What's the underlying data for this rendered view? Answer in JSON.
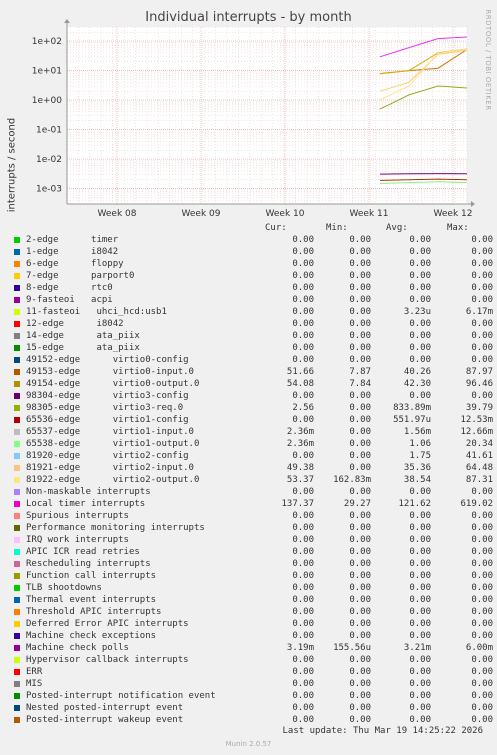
{
  "chart_data": {
    "type": "line",
    "title": "Individual interrupts - by month",
    "ylabel": "interrupts / second",
    "yscale": "log",
    "ylim": [
      0.0003,
      300
    ],
    "yticks": [
      "1e+02",
      "1e+01",
      "1e+00",
      "1e-01",
      "1e-02",
      "1e-03"
    ],
    "xticks": [
      "Week 08",
      "Week 09",
      "Week 10",
      "Week 11",
      "Week 12"
    ],
    "grid": true,
    "series": [
      {
        "name": "49153-edge virtio0-input.0",
        "color": "#cc7700",
        "values": [
          7.87,
          10,
          12,
          51.66
        ]
      },
      {
        "name": "49154-edge virtio0-output.0",
        "color": "#ddaa00",
        "values": [
          7.84,
          10,
          40,
          54.08
        ]
      },
      {
        "name": "98305-edge virtio3-req.0",
        "color": "#99aa22",
        "values": [
          0.5,
          1.5,
          3,
          2.56
        ]
      },
      {
        "name": "Local timer interrupts",
        "color": "#ee33ee",
        "values": [
          29.27,
          60,
          121.62,
          137.37
        ]
      },
      {
        "name": "81921-edge virtio2-input.0",
        "color": "#ffcc66",
        "values": [
          2,
          4,
          35.36,
          49.38
        ]
      },
      {
        "name": "81922-edge virtio2-output.0",
        "color": "#ffe099",
        "values": [
          1,
          3,
          38.54,
          53.37
        ]
      },
      {
        "name": "Machine check polls",
        "color": "#800080",
        "values": [
          0.0031,
          0.0032,
          0.00321,
          0.0032
        ]
      },
      {
        "name": "65538-edge virtio1-output.0",
        "color": "#88ee88",
        "values": [
          0.0015,
          0.0016,
          0.0017,
          0.0016
        ]
      },
      {
        "name": "65536-edge virtio1-config",
        "color": "#aa3300",
        "values": [
          0.0019,
          0.002,
          0.0021,
          0.002
        ]
      }
    ]
  },
  "side_credit": "RRDTOOL / TOBI OETIKER",
  "legend": {
    "headers": {
      "cur": "Cur:",
      "min": "Min:",
      "avg": "Avg:",
      "max": "Max:"
    },
    "rows": [
      {
        "label": "2-edge      timer",
        "color": "#00cc00",
        "cur": "0.00",
        "min": "0.00",
        "avg": "0.00",
        "max": "0.00"
      },
      {
        "label": "1-edge      i8042",
        "color": "#0066b3",
        "cur": "0.00",
        "min": "0.00",
        "avg": "0.00",
        "max": "0.00"
      },
      {
        "label": "6-edge      floppy",
        "color": "#ff8000",
        "cur": "0.00",
        "min": "0.00",
        "avg": "0.00",
        "max": "0.00"
      },
      {
        "label": "7-edge      parport0",
        "color": "#ffcc00",
        "cur": "0.00",
        "min": "0.00",
        "avg": "0.00",
        "max": "0.00"
      },
      {
        "label": "8-edge      rtc0",
        "color": "#330099",
        "cur": "0.00",
        "min": "0.00",
        "avg": "0.00",
        "max": "0.00"
      },
      {
        "label": "9-fasteoi   acpi",
        "color": "#990099",
        "cur": "0.00",
        "min": "0.00",
        "avg": "0.00",
        "max": "0.00"
      },
      {
        "label": "11-fasteoi   uhci_hcd:usb1",
        "color": "#ccff00",
        "cur": "0.00",
        "min": "0.00",
        "avg": "3.23u",
        "max": "6.17m"
      },
      {
        "label": "12-edge      i8042",
        "color": "#ff0000",
        "cur": "0.00",
        "min": "0.00",
        "avg": "0.00",
        "max": "0.00"
      },
      {
        "label": "14-edge      ata_piix",
        "color": "#808080",
        "cur": "0.00",
        "min": "0.00",
        "avg": "0.00",
        "max": "0.00"
      },
      {
        "label": "15-edge      ata_piix",
        "color": "#008f00",
        "cur": "0.00",
        "min": "0.00",
        "avg": "0.00",
        "max": "0.00"
      },
      {
        "label": "49152-edge      virtio0-config",
        "color": "#00487d",
        "cur": "0.00",
        "min": "0.00",
        "avg": "0.00",
        "max": "0.00"
      },
      {
        "label": "49153-edge      virtio0-input.0",
        "color": "#b35a00",
        "cur": "51.66",
        "min": "7.87",
        "avg": "40.26",
        "max": "87.97"
      },
      {
        "label": "49154-edge      virtio0-output.0",
        "color": "#b38f00",
        "cur": "54.08",
        "min": "7.84",
        "avg": "42.30",
        "max": "96.46"
      },
      {
        "label": "98304-edge      virtio3-config",
        "color": "#6b006b",
        "cur": "0.00",
        "min": "0.00",
        "avg": "0.00",
        "max": "0.00"
      },
      {
        "label": "98305-edge      virtio3-req.0",
        "color": "#8fb300",
        "cur": "2.56",
        "min": "0.00",
        "avg": "833.89m",
        "max": "39.79"
      },
      {
        "label": "65536-edge      virtio1-config",
        "color": "#b30000",
        "cur": "0.00",
        "min": "0.00",
        "avg": "551.97u",
        "max": "12.53m"
      },
      {
        "label": "65537-edge      virtio1-input.0",
        "color": "#bebebe",
        "cur": "2.36m",
        "min": "0.00",
        "avg": "1.56m",
        "max": "12.66m"
      },
      {
        "label": "65538-edge      virtio1-output.0",
        "color": "#80ff80",
        "cur": "2.36m",
        "min": "0.00",
        "avg": "1.06",
        "max": "20.34"
      },
      {
        "label": "81920-edge      virtio2-config",
        "color": "#80c9ff",
        "cur": "0.00",
        "min": "0.00",
        "avg": "1.75",
        "max": "41.61"
      },
      {
        "label": "81921-edge      virtio2-input.0",
        "color": "#ffc080",
        "cur": "49.38",
        "min": "0.00",
        "avg": "35.36",
        "max": "64.48"
      },
      {
        "label": "81922-edge      virtio2-output.0",
        "color": "#ffe680",
        "cur": "53.37",
        "min": "162.83m",
        "avg": "38.54",
        "max": "87.31"
      },
      {
        "label": "Non-maskable interrupts",
        "color": "#aa80ff",
        "cur": "0.00",
        "min": "0.00",
        "avg": "0.00",
        "max": "0.00"
      },
      {
        "label": "Local timer interrupts",
        "color": "#ee00cc",
        "cur": "137.37",
        "min": "29.27",
        "avg": "121.62",
        "max": "619.02"
      },
      {
        "label": "Spurious interrupts",
        "color": "#ff8080",
        "cur": "0.00",
        "min": "0.00",
        "avg": "0.00",
        "max": "0.00"
      },
      {
        "label": "Performance monitoring interrupts",
        "color": "#666600",
        "cur": "0.00",
        "min": "0.00",
        "avg": "0.00",
        "max": "0.00"
      },
      {
        "label": "IRQ work interrupts",
        "color": "#ffbfff",
        "cur": "0.00",
        "min": "0.00",
        "avg": "0.00",
        "max": "0.00"
      },
      {
        "label": "APIC ICR read retries",
        "color": "#00ffcc",
        "cur": "0.00",
        "min": "0.00",
        "avg": "0.00",
        "max": "0.00"
      },
      {
        "label": "Rescheduling interrupts",
        "color": "#cc6699",
        "cur": "0.00",
        "min": "0.00",
        "avg": "0.00",
        "max": "0.00"
      },
      {
        "label": "Function call interrupts",
        "color": "#999900",
        "cur": "0.00",
        "min": "0.00",
        "avg": "0.00",
        "max": "0.00"
      },
      {
        "label": "TLB shootdowns",
        "color": "#00cc00",
        "cur": "0.00",
        "min": "0.00",
        "avg": "0.00",
        "max": "0.00"
      },
      {
        "label": "Thermal event interrupts",
        "color": "#0066b3",
        "cur": "0.00",
        "min": "0.00",
        "avg": "0.00",
        "max": "0.00"
      },
      {
        "label": "Threshold APIC interrupts",
        "color": "#ff8000",
        "cur": "0.00",
        "min": "0.00",
        "avg": "0.00",
        "max": "0.00"
      },
      {
        "label": "Deferred Error APIC interrupts",
        "color": "#ffcc00",
        "cur": "0.00",
        "min": "0.00",
        "avg": "0.00",
        "max": "0.00"
      },
      {
        "label": "Machine check exceptions",
        "color": "#330099",
        "cur": "0.00",
        "min": "0.00",
        "avg": "0.00",
        "max": "0.00"
      },
      {
        "label": "Machine check polls",
        "color": "#990099",
        "cur": "3.19m",
        "min": "155.56u",
        "avg": "3.21m",
        "max": "6.00m"
      },
      {
        "label": "Hypervisor callback interrupts",
        "color": "#ccff00",
        "cur": "0.00",
        "min": "0.00",
        "avg": "0.00",
        "max": "0.00"
      },
      {
        "label": "ERR",
        "color": "#ff0000",
        "cur": "0.00",
        "min": "0.00",
        "avg": "0.00",
        "max": "0.00"
      },
      {
        "label": "MIS",
        "color": "#808080",
        "cur": "0.00",
        "min": "0.00",
        "avg": "0.00",
        "max": "0.00"
      },
      {
        "label": "Posted-interrupt notification event",
        "color": "#008f00",
        "cur": "0.00",
        "min": "0.00",
        "avg": "0.00",
        "max": "0.00"
      },
      {
        "label": "Nested posted-interrupt event",
        "color": "#00487d",
        "cur": "0.00",
        "min": "0.00",
        "avg": "0.00",
        "max": "0.00"
      },
      {
        "label": "Posted-interrupt wakeup event",
        "color": "#b35a00",
        "cur": "0.00",
        "min": "0.00",
        "avg": "0.00",
        "max": "0.00"
      }
    ]
  },
  "footer": {
    "last_update": "Last update: Thu Mar 19 14:25:22 2026",
    "munin_version": "Munin 2.0.57"
  }
}
